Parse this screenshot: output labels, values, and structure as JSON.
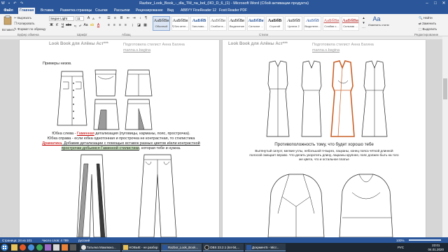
{
  "window": {
    "title": "Razbor_Look_Book_-_dla_TM_na_bol_(IIO_D_6_(1) - Microsoft Word (Сбой активации продукта)",
    "minimize": "–",
    "maximize": "□",
    "close": "✕"
  },
  "ribbon_tabs": [
    {
      "label": "Файл"
    },
    {
      "label": "Главная"
    },
    {
      "label": "Вставка"
    },
    {
      "label": "Разметка страницы"
    },
    {
      "label": "Ссылки"
    },
    {
      "label": "Рассылки"
    },
    {
      "label": "Рецензирование"
    },
    {
      "label": "Вид"
    },
    {
      "label": "ABBYY FineReader 12"
    },
    {
      "label": "Foxit Reader PDF"
    }
  ],
  "clipboard": {
    "paste": "Вставить",
    "cut": "Вырезать",
    "copy": "Копировать",
    "format_painter": "Формат по образцу",
    "group": "Буфер обмена"
  },
  "font": {
    "name": "Segoe Light",
    "size": "11",
    "group": "Шрифт"
  },
  "paragraph": {
    "group": "Абзац"
  },
  "styles": {
    "group": "Стили",
    "items": [
      {
        "sample": "АаБбВв",
        "name": "Обычный"
      },
      {
        "sample": "АаБбВв",
        "name": "¶ Без инте..."
      },
      {
        "sample": "АаБбВ",
        "name": "Заголово..."
      },
      {
        "sample": "АаБбВв",
        "name": "Слабое в..."
      },
      {
        "sample": "АаБбВв",
        "name": "Выделение"
      },
      {
        "sample": "АаБбВв",
        "name": "Сильное ..."
      },
      {
        "sample": "АаБбВ",
        "name": "Строгий"
      },
      {
        "sample": "АаБбВ",
        "name": "Цитата 2"
      },
      {
        "sample": "АаБбВ",
        "name": "Выделенн..."
      },
      {
        "sample": "АаБбВв",
        "name": "Слабая с..."
      },
      {
        "sample": "АаБбВв",
        "name": "Сильная ..."
      }
    ],
    "change": "Изменить стили"
  },
  "editing": {
    "group": "Редактирование",
    "find": "Найти",
    "replace": "Заменить",
    "select": "Выделить"
  },
  "page1": {
    "header_title": "Look Book для Алёны Аст***",
    "header_sub": "Подготовила стилист Анна Багина",
    "header_link": "manna.s.bagina",
    "section": "Примеры низов.",
    "para1_a": "Юбка слева - ",
    "para1_b": "Гаминная",
    "para1_c": " детализация (пуговицы, карманы, пояс, прострочка).",
    "para2": "Юбка справа - если юбка однотонная и прострочка не контрастная, то стилистика",
    "para3_a": "Драматика",
    "para3_b": ". Добавив детализации с помощью вставок разных цветов и/или контрастной",
    "para4_a": "прострочки добьемся Гаминной стилистики",
    "para4_b": ", которая тебе и нужна."
  },
  "page2": {
    "header_title": "Look Book для Алёны Аст***",
    "header_sub": "Подготовила стилист Анна Багина",
    "header_link": "manna.s.bagina",
    "caption": "Противоположность тому, что будет хорошо тебе",
    "para1": "Вытянутый силуэт, мелкие углы, небольшой V-вырез, лацканы, конец пояса чёткой длинной",
    "para2": "полосой смещает вправо. Что делить укоротить длину, лацканы крупнее, пояс должен быть на того",
    "para3": "же цвета, что и остальное платье"
  },
  "status": {
    "page": "Страница: 24 из 101",
    "words": "Число слов: 4 789",
    "lang": "русский",
    "zoom": "100%"
  },
  "taskbar": {
    "items": [
      {
        "label": "Татьяна Мамлюко..."
      },
      {
        "label": "НОВЫЕ - не разбор"
      },
      {
        "label": "Razbor_Look_Book..."
      },
      {
        "label": "OBS 23.2.1 (64-bit,..."
      },
      {
        "label": "Документ5 - Micr..."
      }
    ],
    "time": "23:01",
    "date": "04.01.2020",
    "lang": "РУС"
  },
  "colors": {
    "title_bar": "#2b579a",
    "taskbar": "#1c2733",
    "accent_orange": "#c8622a",
    "highlight_red": "#c00000",
    "highlight_green": "#cfe8c2"
  }
}
